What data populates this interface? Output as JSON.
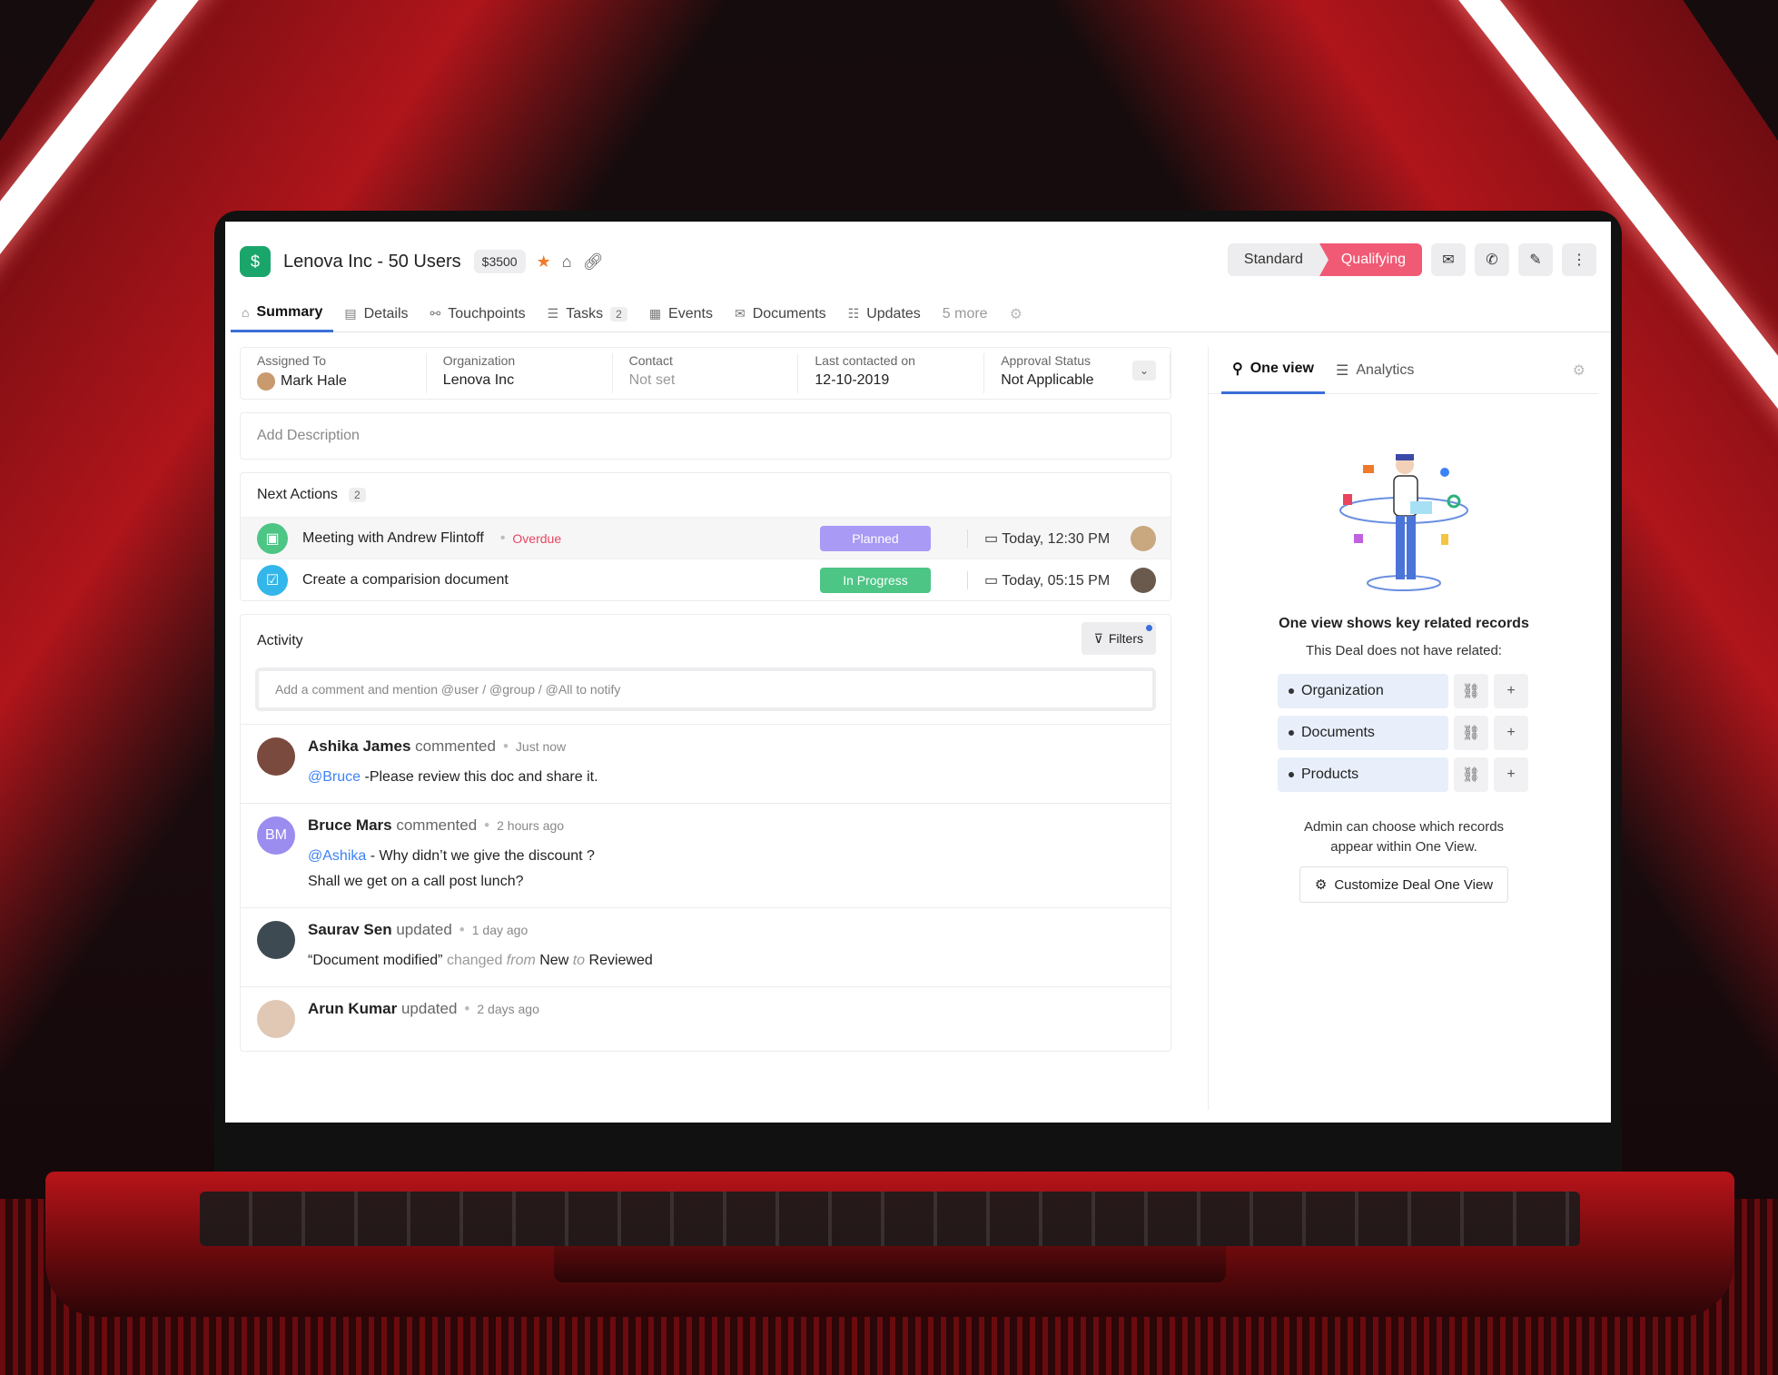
{
  "deal": {
    "title": "Lenova Inc - 50 Users",
    "amount": "$3500",
    "stage_standard": "Standard",
    "stage_current": "Qualifying"
  },
  "tabs": [
    {
      "label": "Summary",
      "icon": "home-icon"
    },
    {
      "label": "Details",
      "icon": "list-icon"
    },
    {
      "label": "Touchpoints",
      "icon": "network-icon"
    },
    {
      "label": "Tasks",
      "icon": "checklist-icon",
      "badge": "2"
    },
    {
      "label": "Events",
      "icon": "calendar-icon"
    },
    {
      "label": "Documents",
      "icon": "mail-icon"
    },
    {
      "label": "Updates",
      "icon": "updates-icon"
    },
    {
      "label": "5 more"
    }
  ],
  "info": {
    "assigned_label": "Assigned To",
    "assigned_value": "Mark Hale",
    "org_label": "Organization",
    "org_value": "Lenova Inc",
    "contact_label": "Contact",
    "contact_value": "Not set",
    "last_label": "Last contacted on",
    "last_value": "12-10-2019",
    "approval_label": "Approval Status",
    "approval_value": "Not Applicable"
  },
  "description_placeholder": "Add Description",
  "next_actions": {
    "title": "Next Actions",
    "count": "2",
    "items": [
      {
        "text": "Meeting with Andrew Flintoff",
        "flag": "Overdue",
        "status": "Planned",
        "when": "Today, 12:30 PM"
      },
      {
        "text": "Create a comparision document",
        "flag": "",
        "status": "In Progress",
        "when": "Today, 05:15 PM"
      }
    ]
  },
  "activity": {
    "title": "Activity",
    "filters_label": "Filters",
    "comment_placeholder": "Add a comment and mention @user / @group / @All to notify",
    "feed": [
      {
        "name": "Ashika James",
        "verb": "commented",
        "time": "Just now",
        "mention": "@Bruce",
        "text": "-Please review this doc and share it."
      },
      {
        "name": "Bruce Mars",
        "initials": "BM",
        "verb": "commented",
        "time": "2 hours ago",
        "mention": "@Ashika",
        "text": " - Why didn’t we give the discount ?",
        "text2": "Shall we get on a call post lunch?"
      },
      {
        "name": "Saurav Sen",
        "verb": "updated",
        "time": "1 day ago",
        "quoted": "“Document modified”",
        "changed": "changed",
        "from": "from",
        "from_val": "New",
        "to": "to",
        "to_val": "Reviewed"
      },
      {
        "name": "Arun Kumar",
        "verb": "updated",
        "time": "2 days ago"
      }
    ]
  },
  "one_view": {
    "tab_active": "One view",
    "tab_other": "Analytics",
    "title": "One view shows key related records",
    "subtitle": "This Deal does not have related:",
    "related": [
      "Organization",
      "Documents",
      "Products"
    ],
    "admin_line1": "Admin can choose which records",
    "admin_line2": "appear within One View.",
    "customize_label": "Customize Deal One View"
  },
  "colors": {
    "accent": "#3b6fd8",
    "stage": "#f05a75",
    "planned": "#a89af5",
    "in_progress": "#4cc585",
    "overdue": "#e8455f",
    "deal_icon": "#1aa66b"
  }
}
